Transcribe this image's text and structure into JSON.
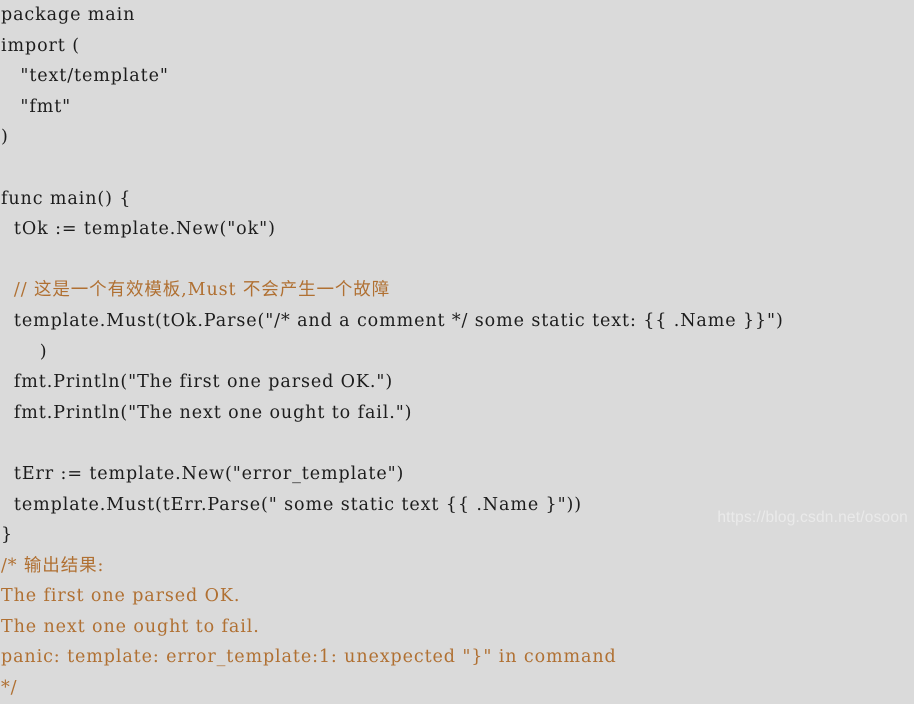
{
  "page": {
    "background_color": "#dadada",
    "code_color": "#1c1c1c",
    "comment_color": "#b07032",
    "language": "go"
  },
  "code": {
    "lines": [
      {
        "text": "package main",
        "kind": "code"
      },
      {
        "text": "import (",
        "kind": "code"
      },
      {
        "text": "   \"text/template\"",
        "kind": "code"
      },
      {
        "text": "   \"fmt\"",
        "kind": "code"
      },
      {
        "text": ")",
        "kind": "code"
      },
      {
        "text": "",
        "kind": "blank"
      },
      {
        "text": "func main() {",
        "kind": "code"
      },
      {
        "text": "  tOk := template.New(\"ok\")",
        "kind": "code"
      },
      {
        "text": "",
        "kind": "blank"
      },
      {
        "text": "  // 这是一个有效模板,Must 不会产生一个故障",
        "kind": "comment"
      },
      {
        "text": "  template.Must(tOk.Parse(\"/* and a comment */ some static text: {{ .Name }}\")",
        "kind": "code"
      },
      {
        "text": "      )",
        "kind": "code"
      },
      {
        "text": "  fmt.Println(\"The first one parsed OK.\")",
        "kind": "code"
      },
      {
        "text": "  fmt.Println(\"The next one ought to fail.\")",
        "kind": "code"
      },
      {
        "text": "",
        "kind": "blank"
      },
      {
        "text": "  tErr := template.New(\"error_template\")",
        "kind": "code"
      },
      {
        "text": "  template.Must(tErr.Parse(\" some static text {{ .Name }\"))",
        "kind": "code"
      },
      {
        "text": "}",
        "kind": "code"
      },
      {
        "text": "/* 输出结果:",
        "kind": "comment"
      },
      {
        "text": "The first one parsed OK.",
        "kind": "comment"
      },
      {
        "text": "The next one ought to fail.",
        "kind": "comment"
      },
      {
        "text": "panic: template: error_template:1: unexpected \"}\" in command",
        "kind": "comment"
      },
      {
        "text": "*/",
        "kind": "comment"
      }
    ]
  },
  "watermark": {
    "text": "https://blog.csdn.net/osoon"
  }
}
